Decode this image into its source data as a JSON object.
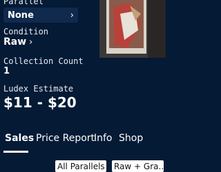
{
  "fields": {
    "parallel_label": "Parallel",
    "parallel_value": "None",
    "condition_label": "Condition",
    "condition_value": "Raw",
    "collection_count_label": "Collection Count",
    "collection_count_value": "1",
    "estimate_label": "Ludex Estimate",
    "estimate_value": "$11 - $20"
  },
  "icons": {
    "parallel_chevron": "chevron-right",
    "condition_chevron": "chevron-right",
    "dropdown_caret": "caret-down"
  },
  "tabs": [
    {
      "label": "Sales",
      "active": true
    },
    {
      "label": "Price Report",
      "active": false
    },
    {
      "label": "Info",
      "active": false
    },
    {
      "label": "Shop",
      "active": false
    }
  ],
  "filters": {
    "parallels": "All Parallels",
    "grade": "Raw + Gra..."
  },
  "colors": {
    "background": "#041a35",
    "select_bg": "#0f2a4d",
    "text": "#ffffff"
  }
}
